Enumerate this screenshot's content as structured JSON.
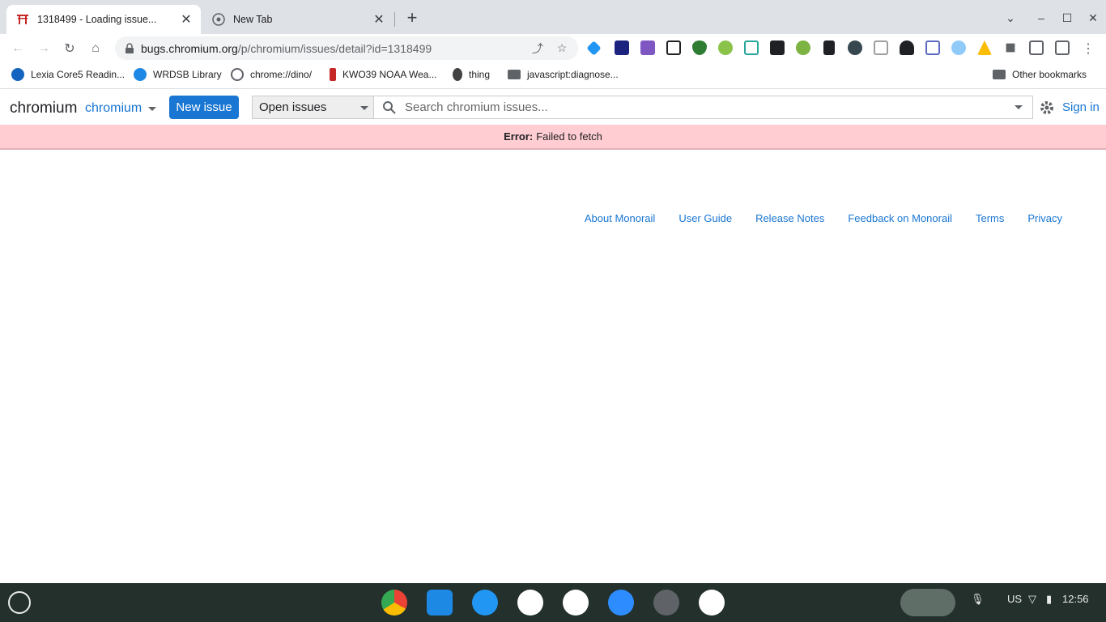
{
  "browser": {
    "tabs": [
      {
        "title": "1318499 - Loading issue...",
        "active": true
      },
      {
        "title": "New Tab",
        "active": false
      }
    ],
    "omnibox": {
      "host": "bugs.chromium.org",
      "path": "/p/chromium/issues/detail?id=1318499"
    },
    "bookmarks": [
      {
        "label": "Lexia Core5 Readin..."
      },
      {
        "label": "WRDSB Library"
      },
      {
        "label": "chrome://dino/"
      },
      {
        "label": "KWO39 NOAA Wea..."
      },
      {
        "label": "thing"
      },
      {
        "label": "javascript:diagnose..."
      }
    ],
    "other_bookmarks": "Other bookmarks"
  },
  "app": {
    "brand": "chromium",
    "project": "chromium",
    "new_issue": "New issue",
    "can_select": "Open issues",
    "search_placeholder": "Search chromium issues...",
    "sign_in": "Sign in"
  },
  "error": {
    "label": "Error:",
    "message": "Failed to fetch"
  },
  "footer": {
    "links": [
      "About Monorail",
      "User Guide",
      "Release Notes",
      "Feedback on Monorail",
      "Terms",
      "Privacy"
    ]
  },
  "shelf": {
    "ime": "US",
    "time": "12:56"
  },
  "colors": {
    "link": "#1976d2",
    "error_bg": "#ffcdd2",
    "chrome_frame": "#dee1e6",
    "shelf": "#23302b"
  }
}
